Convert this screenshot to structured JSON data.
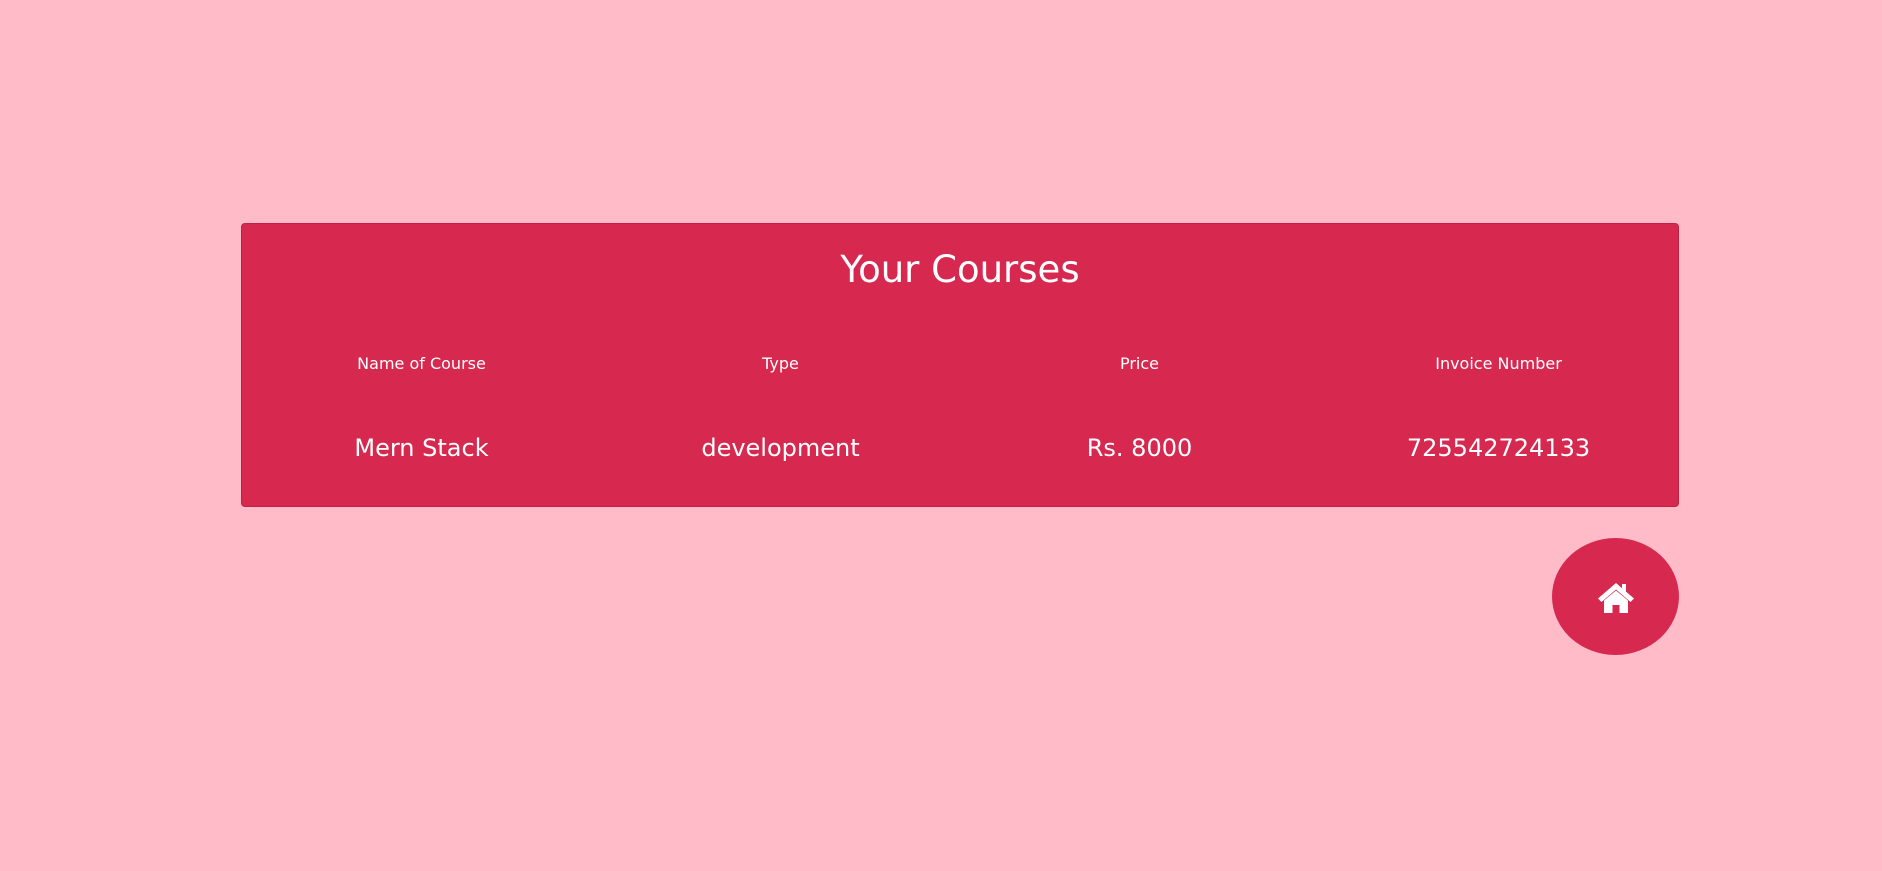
{
  "page": {
    "background_color": "#ffbcc8",
    "accent_color": "#d72950"
  },
  "courses": {
    "title": "Your Courses",
    "columns": [
      "Name of Course",
      "Type",
      "Price",
      "Invoice Number"
    ],
    "rows": [
      {
        "name": "Mern Stack",
        "type": "development",
        "price": "Rs. 8000",
        "invoice": "725542724133"
      }
    ]
  },
  "home_button": {
    "icon": "home-icon"
  }
}
